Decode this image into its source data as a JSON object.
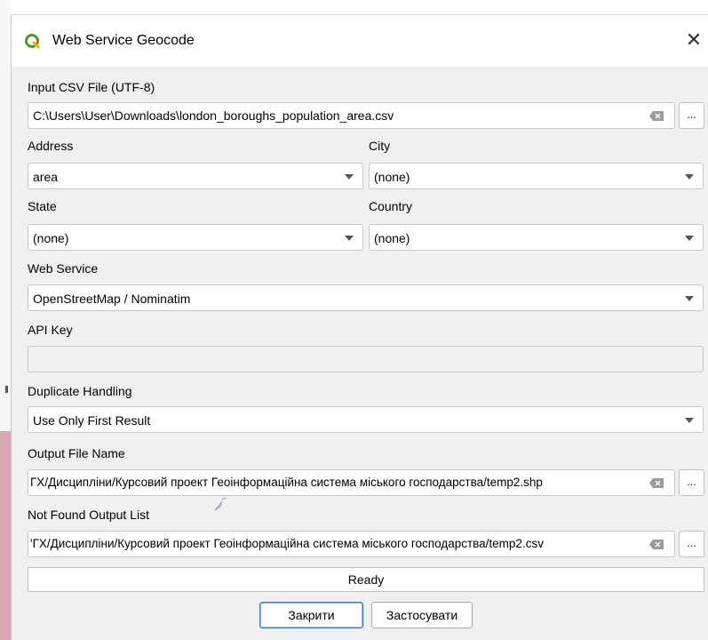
{
  "window": {
    "title": "Web Service Geocode",
    "icon": "qgis-icon"
  },
  "form": {
    "input_csv": {
      "label": "Input CSV File (UTF-8)",
      "value": "C:\\Users\\User\\Downloads\\london_boroughs_population_area.csv",
      "browse": "..."
    },
    "address": {
      "label": "Address",
      "value": "area"
    },
    "city": {
      "label": "City",
      "value": "(none)"
    },
    "state": {
      "label": "State",
      "value": "(none)"
    },
    "country": {
      "label": "Country",
      "value": "(none)"
    },
    "web_service": {
      "label": "Web Service",
      "value": "OpenStreetMap / Nominatim"
    },
    "api_key": {
      "label": "API Key",
      "value": ""
    },
    "duplicate": {
      "label": "Duplicate Handling",
      "value": "Use Only First Result"
    },
    "output_file": {
      "label": "Output File Name",
      "value": "ГХ/Дисципліни/Курсовий проект Геоінформаційна система міського господарства/temp2.shp",
      "browse": "..."
    },
    "not_found": {
      "label": "Not Found Output List",
      "value": "'ГХ/Дисципліни/Курсовий проект Геоінформаційна система міського господарства/temp2.csv",
      "browse": "..."
    }
  },
  "status": {
    "text": "Ready"
  },
  "buttons": {
    "close": "Закрити",
    "apply": "Застосувати"
  }
}
